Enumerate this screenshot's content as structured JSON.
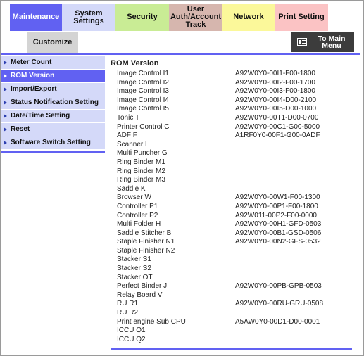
{
  "tabs": {
    "maintenance": "Maintenance",
    "system_settings": "System Settings",
    "security": "Security",
    "user_auth": [
      "User",
      "Auth/Account",
      "Track"
    ],
    "network": "Network",
    "print_setting": "Print Setting",
    "customize": "Customize"
  },
  "main_menu_button": [
    "To Main",
    "Menu"
  ],
  "sidebar": {
    "items": [
      {
        "label": "Meter Count",
        "active": false
      },
      {
        "label": "ROM Version",
        "active": true
      },
      {
        "label": "Import/Export",
        "active": false
      },
      {
        "label": "Status Notification Setting",
        "active": false
      },
      {
        "label": "Date/Time Setting",
        "active": false
      },
      {
        "label": "Reset",
        "active": false
      },
      {
        "label": "Software Switch Setting",
        "active": false
      }
    ]
  },
  "content": {
    "title": "ROM Version",
    "rows": [
      {
        "name": "Image Control I1",
        "version": "A92W0Y0-00I1-F00-1800"
      },
      {
        "name": "Image Control I2",
        "version": "A92W0Y0-00I2-F00-1700"
      },
      {
        "name": "Image Control I3",
        "version": "A92W0Y0-00I3-F00-1800"
      },
      {
        "name": "Image Control I4",
        "version": "A92W0Y0-00I4-D00-2100"
      },
      {
        "name": "Image Control I5",
        "version": "A92W0Y0-00I5-D00-1000"
      },
      {
        "name": "Tonic T",
        "version": "A92W0Y0-00T1-D00-0700"
      },
      {
        "name": "Printer Control C",
        "version": "A92W0Y0-00C1-G00-5000"
      },
      {
        "name": "ADF F",
        "version": "A1RF0Y0-00F1-G00-0ADF"
      },
      {
        "name": "Scanner L",
        "version": ""
      },
      {
        "name": "Multi Puncher G",
        "version": ""
      },
      {
        "name": "Ring Binder M1",
        "version": ""
      },
      {
        "name": "Ring Binder M2",
        "version": ""
      },
      {
        "name": "Ring Binder M3",
        "version": ""
      },
      {
        "name": "Saddle K",
        "version": ""
      },
      {
        "name": "Browser W",
        "version": "A92W0Y0-00W1-F00-1300"
      },
      {
        "name": "Controller P1",
        "version": "A92W0Y0-00P1-F00-1800"
      },
      {
        "name": "Controller P2",
        "version": "A92W011-00P2-F00-0000"
      },
      {
        "name": "Multi Folder H",
        "version": "A92W0Y0-00H1-GFD-0503"
      },
      {
        "name": "Saddle Stitcher B",
        "version": "A92W0Y0-00B1-GSD-0506"
      },
      {
        "name": "Staple Finisher N1",
        "version": "A92W0Y0-00N2-GFS-0532"
      },
      {
        "name": "Staple Finisher N2",
        "version": ""
      },
      {
        "name": "Stacker S1",
        "version": ""
      },
      {
        "name": "Stacker S2",
        "version": ""
      },
      {
        "name": "Stacker OT",
        "version": ""
      },
      {
        "name": "Perfect Binder J",
        "version": "A92W0Y0-00PB-GPB-0503"
      },
      {
        "name": "Relay Board V",
        "version": ""
      },
      {
        "name": "RU R1",
        "version": "A92W0Y0-00RU-GRU-0508"
      },
      {
        "name": "RU R2",
        "version": ""
      },
      {
        "name": "Print engine Sub CPU",
        "version": "A5AW0Y0-00D1-D00-0001"
      },
      {
        "name": "ICCU Q1",
        "version": ""
      },
      {
        "name": "ICCU Q2",
        "version": ""
      }
    ]
  },
  "colors": {
    "accent": "#6161f2",
    "sidebar_bg": "#d4d9f9",
    "security_tab": "#c9ec95",
    "auth_tab": "#d6b6ae",
    "network_tab": "#fbf89a",
    "print_tab": "#fbc3c4"
  }
}
